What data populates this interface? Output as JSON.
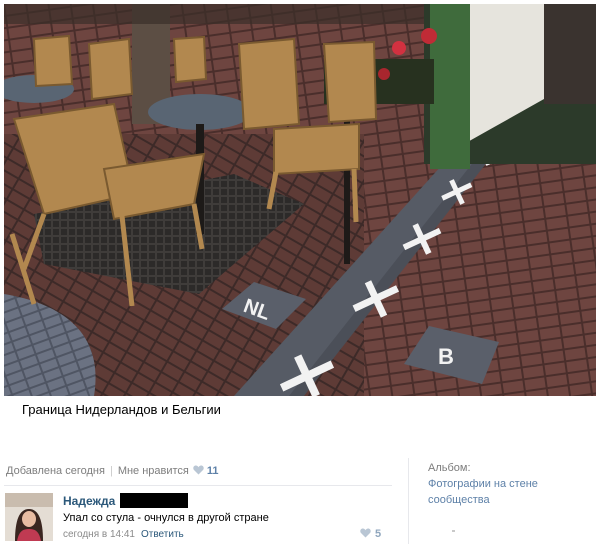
{
  "photo": {
    "alt": ""
  },
  "caption": "Граница Нидерландов и Бельгии",
  "meta": {
    "added": "Добавлена сегодня",
    "like_label": "Мне нравится",
    "like_count": "11"
  },
  "album": {
    "label": "Альбом:",
    "link": "Фотографии на стене сообщества"
  },
  "comment": {
    "author": "Надежда",
    "text": "Упал со стула - очнулся в другой стране",
    "time": "сегодня в 14:41",
    "reply": "Ответить",
    "likes": "5"
  },
  "colors": {
    "link": "#2b587a",
    "muted": "#7d7d7d",
    "like_accent": "#5e81a8"
  }
}
